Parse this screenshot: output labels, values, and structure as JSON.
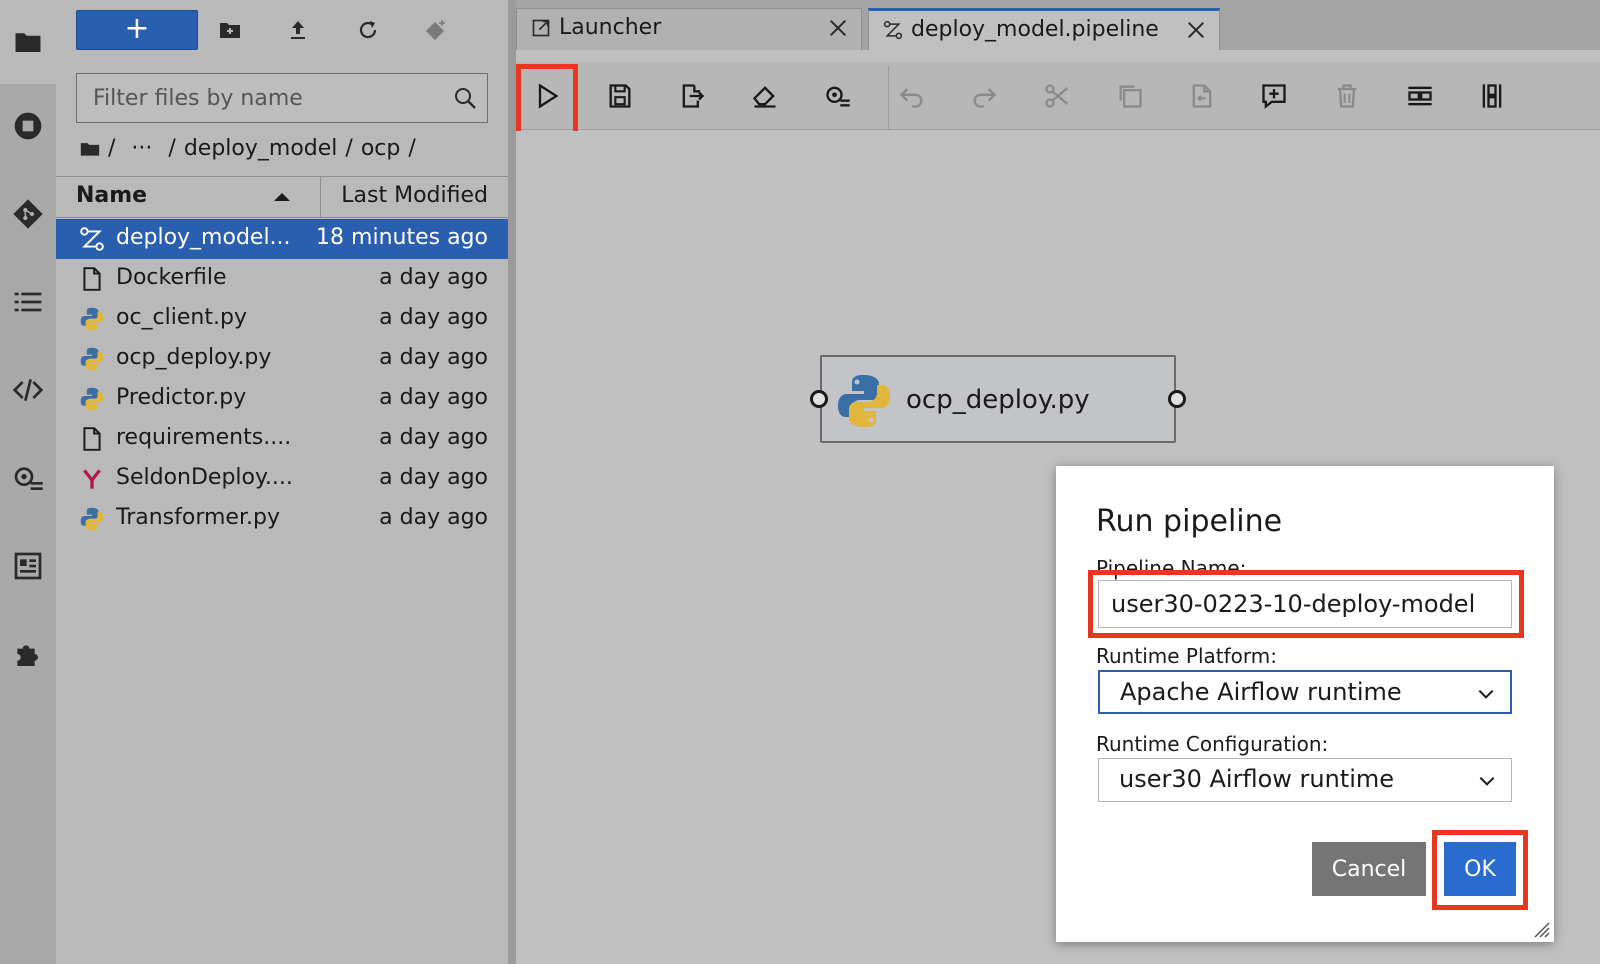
{
  "file_browser": {
    "new_button_label": "+",
    "filter_placeholder": "Filter files by name",
    "breadcrumb": {
      "root": "/",
      "ellipsis": "···",
      "sep1": "/",
      "seg1": "deploy_model",
      "sep2": "/",
      "seg2": "ocp",
      "sep3": "/"
    },
    "columns": {
      "name": "Name",
      "modified": "Last Modified"
    },
    "files": [
      {
        "name": "deploy_model...",
        "modified": "18 minutes ago",
        "icon": "pipeline-icon",
        "selected": true
      },
      {
        "name": "Dockerfile",
        "modified": "a day ago",
        "icon": "file-icon"
      },
      {
        "name": "oc_client.py",
        "modified": "a day ago",
        "icon": "python-icon"
      },
      {
        "name": "ocp_deploy.py",
        "modified": "a day ago",
        "icon": "python-icon"
      },
      {
        "name": "Predictor.py",
        "modified": "a day ago",
        "icon": "python-icon"
      },
      {
        "name": "requirements....",
        "modified": "a day ago",
        "icon": "file-icon"
      },
      {
        "name": "SeldonDeploy....",
        "modified": "a day ago",
        "icon": "yaml-icon"
      },
      {
        "name": "Transformer.py",
        "modified": "a day ago",
        "icon": "python-icon"
      }
    ]
  },
  "tabs": [
    {
      "label": "Launcher",
      "icon": "launch-icon"
    },
    {
      "label": "deploy_model.pipeline",
      "icon": "pipeline-icon",
      "active": true
    }
  ],
  "canvas": {
    "node_label": "ocp_deploy.py"
  },
  "dialog": {
    "title": "Run pipeline",
    "name_label": "Pipeline Name:",
    "name_value": "user30-0223-10-deploy-model",
    "platform_label": "Runtime Platform:",
    "platform_value": "Apache Airflow runtime",
    "config_label": "Runtime Configuration:",
    "config_value": "user30 Airflow runtime",
    "cancel_label": "Cancel",
    "ok_label": "OK"
  },
  "colors": {
    "accent": "#2a5fb0",
    "highlight": "#e8371f",
    "ok_button": "#2a6bd0",
    "cancel_button": "#757575"
  }
}
